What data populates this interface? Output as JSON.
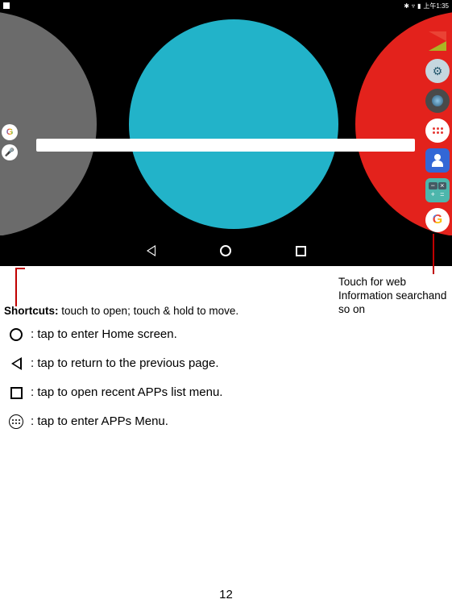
{
  "statusbar": {
    "time": "上午1:35"
  },
  "callouts": {
    "touch_for_web": "Touch for web Information searchand so on",
    "shortcuts_label": "Shortcuts:",
    "shortcuts_desc": " touch to open; touch & hold to move."
  },
  "nav_explain": {
    "home": ": tap to enter Home screen.",
    "back": ": tap to return to the previous page.",
    "recent": ": tap to open recent APPs list menu.",
    "apps": ": tap to enter APPs Menu."
  },
  "page_number": "12"
}
